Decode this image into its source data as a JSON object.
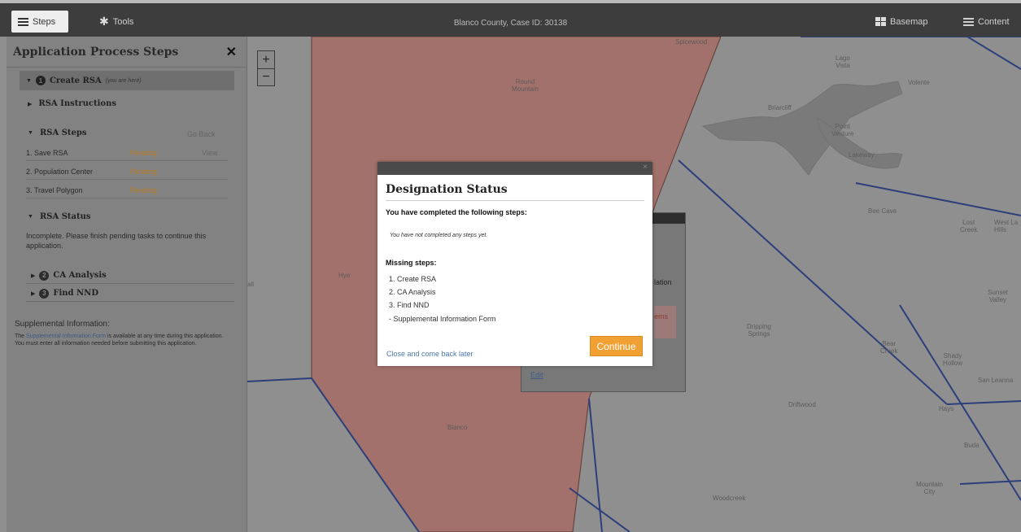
{
  "topbar": {
    "steps_label": "Steps",
    "tools_label": "Tools",
    "title": "Blanco County, Case ID: 30138",
    "basemap_label": "Basemap",
    "content_label": "Content"
  },
  "panel": {
    "title": "Application Process Steps",
    "create_rsa": {
      "label": "Create RSA",
      "note": "(you are here)",
      "num": "1"
    },
    "rsa_instructions": "RSA Instructions",
    "rsa_steps": "RSA Steps",
    "go_back": "Go Back",
    "steps": [
      {
        "label": "1. Save RSA",
        "status": "Pending",
        "action": "View"
      },
      {
        "label": "2. Population Center",
        "status": "Pending",
        "action": ""
      },
      {
        "label": "3. Travel Polygon",
        "status": "Pending",
        "action": ""
      }
    ],
    "rsa_status": "RSA Status",
    "status_text": "Incomplete. Please finish pending tasks to continue this application.",
    "phases": [
      {
        "num": "2",
        "label": "CA Analysis"
      },
      {
        "num": "3",
        "label": "Find NND"
      }
    ],
    "supplemental": {
      "heading": "Supplemental Information:",
      "prefix": "The ",
      "link": "Supplemental Information Form",
      "suffix": " is available at any time during this application. You must enter all information needed before submitting this application."
    }
  },
  "map": {
    "labels": {
      "spicewood": "Spicewood",
      "lago_vista": "Lago\nVista",
      "volente": "Volente",
      "round_mountain": "Round\nMountain",
      "briarcliff": "Briarcliff",
      "point_venture": "Point\nVenture",
      "lakeway": "Lakeway",
      "bee_cave": "Bee Cave",
      "lost_creek": "Lost\nCreek",
      "west_lake_hills": "West La\nHills",
      "sunset_valley": "Sunset\nValley",
      "hye": "Hye",
      "all": "all",
      "dripping_springs": "Dripping\nSprings",
      "bear_creek": "Bear\nCreek",
      "shady_hollow": "Shady\nHollow",
      "san_leanna": "San Leanna",
      "driftwood": "Driftwood",
      "hays": "Hays",
      "blanco": "Blanco",
      "buda": "Buda",
      "mountain_city": "Mountain\nCity",
      "woodcreek": "Woodcreek"
    },
    "zoom_in": "+",
    "zoom_out": "−"
  },
  "back_dialog": {
    "lation": "lation",
    "ems": "ems",
    "edit": "Edit"
  },
  "dialog": {
    "title": "Designation Status",
    "completed_heading": "You have completed the following steps:",
    "none_text": "You have not completed any steps yet.",
    "missing_heading": "Missing steps:",
    "missing": [
      "1. Create RSA",
      "2. CA Analysis",
      "3. Find NND",
      "- Supplemental Information Form"
    ],
    "close_link": "Close and come back later",
    "continue_label": "Continue",
    "close_x": "×"
  },
  "colors": {
    "polygon_fill": "#a3716b",
    "boundary_line": "#2c3f7a",
    "accent_orange": "#f1a133",
    "pending_text": "#b97b20"
  }
}
